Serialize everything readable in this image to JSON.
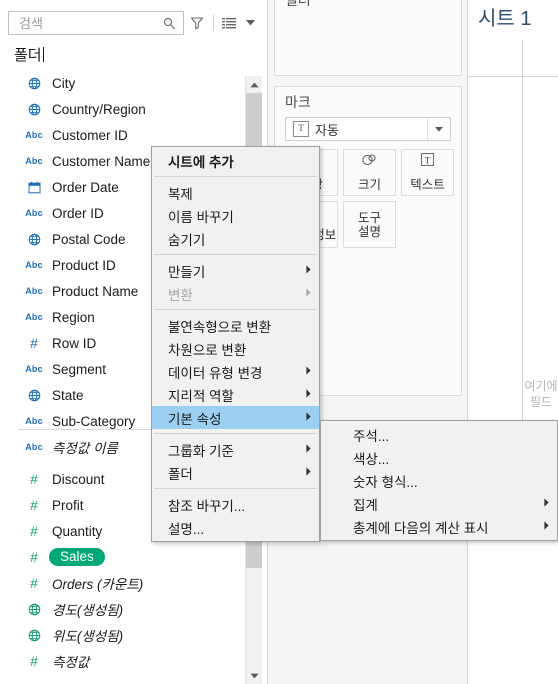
{
  "search": {
    "value": "",
    "placeholder": "검색",
    "search_icon": "search-icon",
    "filter_icon": "funnel-icon",
    "view_icon": "list-view-icon",
    "dropdown_icon": "chevron-down-icon"
  },
  "folder_header": "폴더",
  "fields": [
    {
      "icon": "globe-icon",
      "type": "geo",
      "label": "City",
      "italic": false,
      "selected": false
    },
    {
      "icon": "globe-icon",
      "type": "geo",
      "label": "Country/Region",
      "italic": false,
      "selected": false
    },
    {
      "icon": "abc-icon",
      "type": "text",
      "label": "Customer ID",
      "italic": false,
      "selected": false
    },
    {
      "icon": "abc-icon",
      "type": "text",
      "label": "Customer Name",
      "italic": false,
      "selected": false
    },
    {
      "icon": "calendar-icon",
      "type": "date",
      "label": "Order Date",
      "italic": false,
      "selected": false
    },
    {
      "icon": "abc-icon",
      "type": "text",
      "label": "Order ID",
      "italic": false,
      "selected": false
    },
    {
      "icon": "globe-icon",
      "type": "geo",
      "label": "Postal Code",
      "italic": false,
      "selected": false
    },
    {
      "icon": "abc-icon",
      "type": "text",
      "label": "Product ID",
      "italic": false,
      "selected": false
    },
    {
      "icon": "abc-icon",
      "type": "text",
      "label": "Product Name",
      "italic": false,
      "selected": false
    },
    {
      "icon": "abc-icon",
      "type": "text",
      "label": "Region",
      "italic": false,
      "selected": false
    },
    {
      "icon": "hash-icon",
      "type": "number-dim",
      "label": "Row ID",
      "italic": false,
      "selected": false
    },
    {
      "icon": "abc-icon",
      "type": "text",
      "label": "Segment",
      "italic": false,
      "selected": false
    },
    {
      "icon": "globe-icon",
      "type": "geo",
      "label": "State",
      "italic": false,
      "selected": false
    },
    {
      "icon": "abc-icon",
      "type": "text",
      "label": "Sub-Category",
      "italic": false,
      "selected": false
    },
    {
      "icon": "abc-icon",
      "type": "text",
      "label": "측정값 이름",
      "italic": true,
      "selected": false
    }
  ],
  "measures": [
    {
      "icon": "hash-icon",
      "label": "Discount",
      "italic": false,
      "selected": false
    },
    {
      "icon": "hash-icon",
      "label": "Profit",
      "italic": false,
      "selected": false
    },
    {
      "icon": "hash-icon",
      "label": "Quantity",
      "italic": false,
      "selected": false
    },
    {
      "icon": "hash-icon",
      "label": "Sales",
      "italic": false,
      "selected": true
    },
    {
      "icon": "hash-icon",
      "label": "Orders (카운트)",
      "italic": true,
      "selected": false
    },
    {
      "icon": "globe-icon",
      "label": "경도(생성됨)",
      "italic": true,
      "selected": false
    },
    {
      "icon": "globe-icon",
      "label": "위도(생성됨)",
      "italic": true,
      "selected": false
    },
    {
      "icon": "hash-icon",
      "label": "측정값",
      "italic": true,
      "selected": false
    }
  ],
  "cards": {
    "filter_title": "필터",
    "marks_title": "마크",
    "mark_type": "자동",
    "mark_type_icon": "text-mark-icon",
    "mark_type_arrow": "chevron-down-icon",
    "buttons": [
      {
        "name": "color",
        "label": "색상",
        "icon": "palette-icon"
      },
      {
        "name": "size",
        "label": "크기",
        "icon": "size-icon"
      },
      {
        "name": "text",
        "label": "텍스트",
        "icon": "text-icon"
      },
      {
        "name": "detail",
        "label": "세부 정보",
        "icon": "detail-icon"
      },
      {
        "name": "tooltip",
        "label": "도구 설명",
        "icon": "tooltip-icon"
      }
    ],
    "size_label": "크기",
    "text_label": "텍스트",
    "tooltip_label_line1": "도구",
    "tooltip_label_line2": "설명"
  },
  "sheet": {
    "title": "시트 1",
    "drop_hint_line1": "여기에",
    "drop_hint_line2": "필드"
  },
  "context_menu": {
    "items": [
      {
        "label": "시트에 추가",
        "bold": true,
        "submenu": false,
        "disabled": false,
        "selected": false,
        "sep_after": true
      },
      {
        "label": "복제",
        "bold": false,
        "submenu": false,
        "disabled": false,
        "selected": false,
        "sep_after": false
      },
      {
        "label": "이름 바꾸기",
        "bold": false,
        "submenu": false,
        "disabled": false,
        "selected": false,
        "sep_after": false
      },
      {
        "label": "숨기기",
        "bold": false,
        "submenu": false,
        "disabled": false,
        "selected": false,
        "sep_after": true
      },
      {
        "label": "만들기",
        "bold": false,
        "submenu": true,
        "disabled": false,
        "selected": false,
        "sep_after": false
      },
      {
        "label": "변환",
        "bold": false,
        "submenu": true,
        "disabled": true,
        "selected": false,
        "sep_after": true
      },
      {
        "label": "불연속형으로 변환",
        "bold": false,
        "submenu": false,
        "disabled": false,
        "selected": false,
        "sep_after": false
      },
      {
        "label": "차원으로 변환",
        "bold": false,
        "submenu": false,
        "disabled": false,
        "selected": false,
        "sep_after": false
      },
      {
        "label": "데이터 유형 변경",
        "bold": false,
        "submenu": true,
        "disabled": false,
        "selected": false,
        "sep_after": false
      },
      {
        "label": "지리적 역할",
        "bold": false,
        "submenu": true,
        "disabled": false,
        "selected": false,
        "sep_after": false
      },
      {
        "label": "기본 속성",
        "bold": false,
        "submenu": true,
        "disabled": false,
        "selected": true,
        "sep_after": true
      },
      {
        "label": "그룹화 기준",
        "bold": false,
        "submenu": true,
        "disabled": false,
        "selected": false,
        "sep_after": false
      },
      {
        "label": "폴더",
        "bold": false,
        "submenu": true,
        "disabled": false,
        "selected": false,
        "sep_after": true
      },
      {
        "label": "참조 바꾸기...",
        "bold": false,
        "submenu": false,
        "disabled": false,
        "selected": false,
        "sep_after": false
      },
      {
        "label": "설명...",
        "bold": false,
        "submenu": false,
        "disabled": false,
        "selected": false,
        "sep_after": false
      }
    ]
  },
  "sub_menu": {
    "items": [
      {
        "label": "주석...",
        "submenu": false
      },
      {
        "label": "색상...",
        "submenu": false
      },
      {
        "label": "숫자 형식...",
        "submenu": false
      },
      {
        "label": "집계",
        "submenu": true
      },
      {
        "label": "총계에 다음의 계산 표시",
        "submenu": true
      }
    ]
  },
  "colors": {
    "dimension_blue": "#1f6fb5",
    "measure_green": "#1a9e79",
    "pill_green": "#00a878",
    "menu_highlight": "#9cd0f2",
    "sheet_title": "#2b4c6f"
  }
}
